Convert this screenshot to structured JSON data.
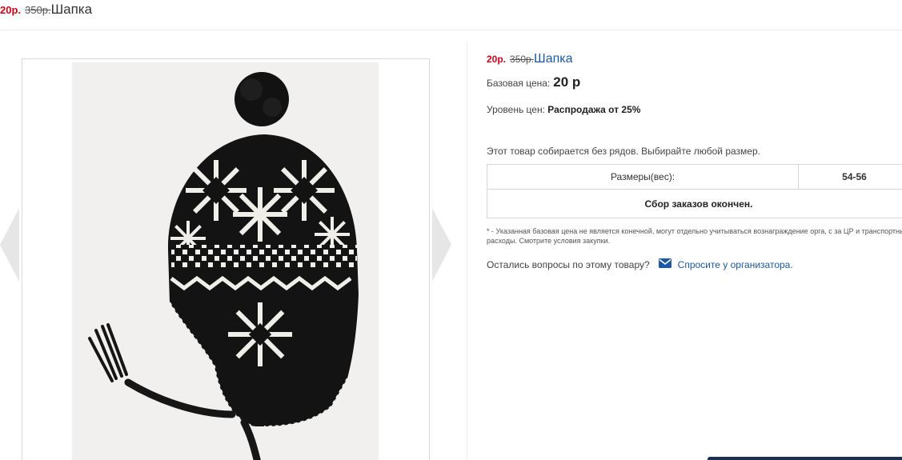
{
  "header": {
    "price_new": "20р.",
    "price_old": "350р.",
    "title": "Шапка"
  },
  "product": {
    "price_new": "20р.",
    "price_old": "350р.",
    "title": "Шапка",
    "base_price_label": "Базовая цена:",
    "base_price_value": "20 р",
    "level_label": "Уровень цен:",
    "level_value": "Распродажа от 25%",
    "rows_note": "Этот товар собирается без рядов. Выбирайте любой размер.",
    "size_label": "Размеры(вес):",
    "size_value": "54-56",
    "orders_closed": "Сбор заказов окончен.",
    "footnote": "* - Указанная базовая цена не является конечной, могут отдельно учитываться вознаграждение орга, с за ЦР и транспортные расходы. Смотрите условия закупки.",
    "question_text": "Остались вопросы по этому товару?",
    "ask_link": "Спросите у организатора."
  },
  "icons": {
    "mail": "envelope-icon",
    "prev": "chevron-left-icon",
    "next": "chevron-right-icon"
  },
  "colors": {
    "sale_price": "#d0021b",
    "link": "#1a5aa6",
    "border": "#d6d6d6"
  }
}
